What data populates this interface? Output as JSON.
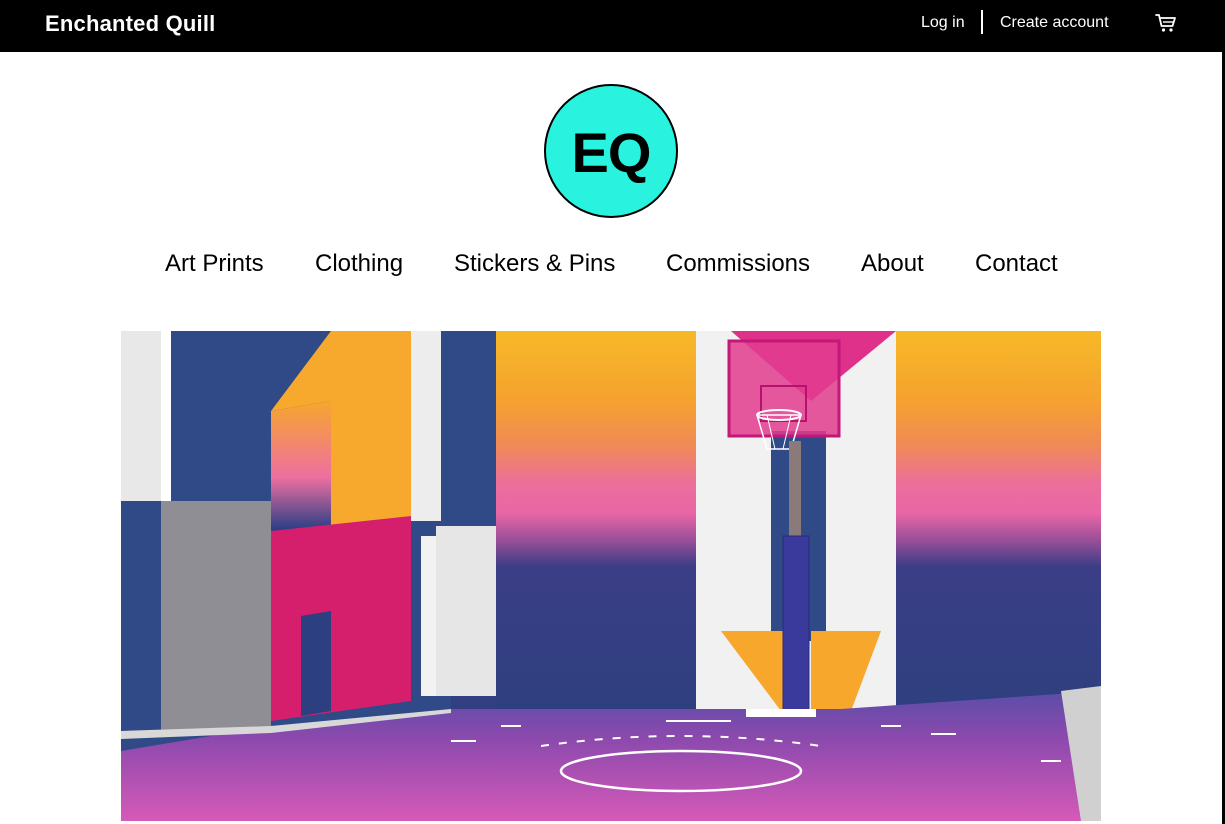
{
  "topbar": {
    "brand": "Enchanted Quill",
    "login_label": "Log in",
    "create_account_label": "Create account",
    "cart_icon": "cart-icon",
    "background": "#000000"
  },
  "logo": {
    "text": "EQ",
    "color": "#29f2df"
  },
  "nav": {
    "items": [
      {
        "label": "Art Prints"
      },
      {
        "label": "Clothing"
      },
      {
        "label": "Stickers & Pins"
      },
      {
        "label": "Commissions"
      },
      {
        "label": "About"
      },
      {
        "label": "Contact"
      }
    ]
  },
  "hero": {
    "palette": {
      "navy": "#2f4a86",
      "orange": "#f6a92c",
      "pink": "#e9609a",
      "magenta": "#d61f6c",
      "white": "#f2f2f2",
      "court": "#c04cb0"
    }
  }
}
